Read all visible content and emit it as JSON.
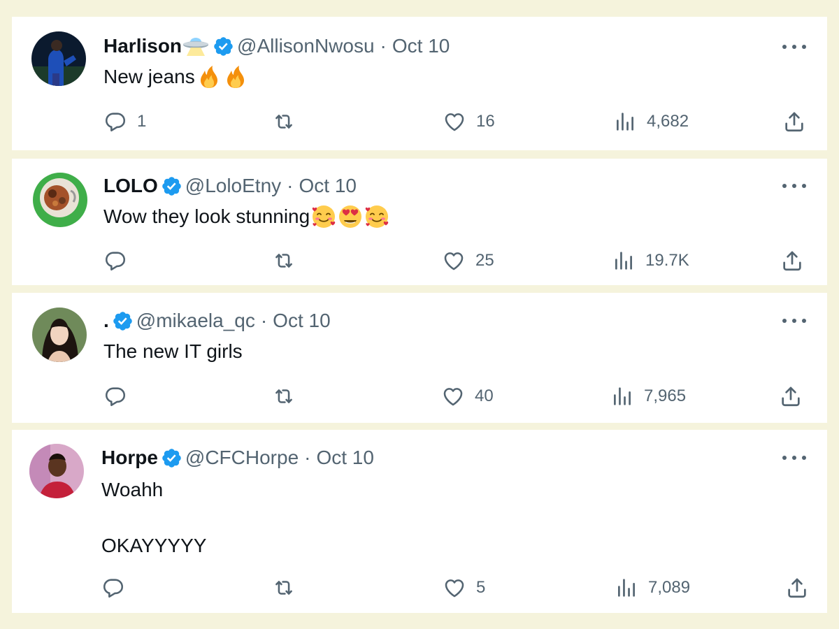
{
  "tweets": [
    {
      "name": "Harlison",
      "handle": "@AllisonNwosu",
      "date": "Oct 10",
      "text": "New jeans",
      "replies": "1",
      "likes": "16",
      "views": "4,682"
    },
    {
      "name": "LOLO",
      "handle": "@LoloEtny",
      "date": "Oct 10",
      "text": "Wow they look stunning",
      "replies": "",
      "likes": "25",
      "views": "19.7K"
    },
    {
      "name": ".",
      "handle": "@mikaela_qc",
      "date": "Oct 10",
      "text": "The new IT girls",
      "replies": "",
      "likes": "40",
      "views": "7,965"
    },
    {
      "name": "Horpe",
      "handle": "@CFCHorpe",
      "date": "Oct 10",
      "text": "Woahh\n\nOKAYYYYY",
      "replies": "",
      "likes": "5",
      "views": "7,089"
    }
  ],
  "separator": "·",
  "colors": {
    "page_background": "#f5f3dc",
    "card_background": "#ffffff",
    "verified": "#1d9bf0",
    "muted": "#536471",
    "text": "#0f1419"
  },
  "icons": [
    "verified-badge-icon",
    "reply-icon",
    "retweet-icon",
    "like-icon",
    "views-icon",
    "share-icon",
    "more-icon",
    "ufo-emoji",
    "fire-emoji",
    "smiling-hearts-emoji",
    "heart-eyes-emoji"
  ]
}
